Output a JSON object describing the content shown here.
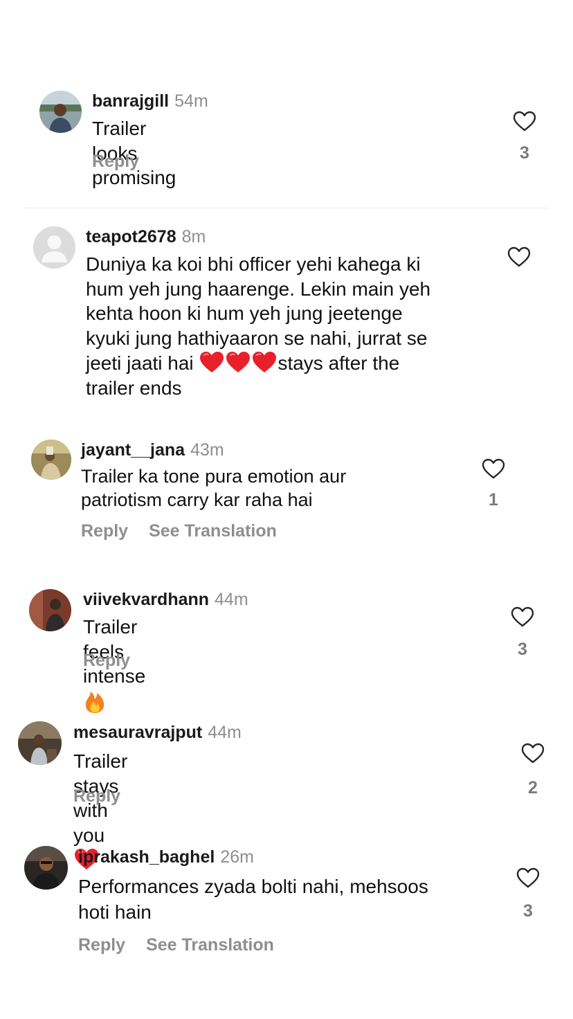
{
  "comments": [
    {
      "username": "banrajgill",
      "time": "54m",
      "text": "Trailer looks promising",
      "actions": [
        "Reply"
      ],
      "likes": "3"
    },
    {
      "username": "teapot2678",
      "time": "8m",
      "text_lines": [
        "Duniya ka koi bhi officer yehi kahega ki",
        "hum yeh jung haarenge. Lekin main yeh",
        "kehta hoon ki hum yeh jung jeetenge",
        "kyuki jung hathiyaaron se nahi, jurrat se"
      ],
      "text_line5_before": "jeeti jaati hai",
      "text_line5_after": "stays after the",
      "text_line6": "trailer ends",
      "actions": [],
      "likes": ""
    },
    {
      "username": "jayant__jana",
      "time": "43m",
      "text_lines": [
        "Trailer ka tone pura emotion aur",
        "patriotism carry kar raha hai"
      ],
      "actions": [
        "Reply",
        "See Translation"
      ],
      "likes": "1"
    },
    {
      "username": "viivekvardhann",
      "time": "44m",
      "text": "Trailer feels intense",
      "actions": [
        "Reply"
      ],
      "likes": "3"
    },
    {
      "username": "mesauravrajput",
      "time": "44m",
      "text": "Trailer stays with you",
      "actions": [
        "Reply"
      ],
      "likes": "2"
    },
    {
      "username": "iprakash_baghel",
      "time": "26m",
      "text_lines": [
        "Performances zyada bolti nahi, mehsoos",
        "hoti hain"
      ],
      "actions": [
        "Reply",
        "See Translation"
      ],
      "likes": "3"
    }
  ],
  "icons": {
    "like": "heart-outline-icon",
    "emoji_heart": "red-heart-emoji",
    "emoji_fire": "fire-emoji",
    "default_avatar": "default-avatar-icon"
  },
  "colors": {
    "secondary_text": "#8e8e8e",
    "emoji_red": "#e8202a"
  }
}
